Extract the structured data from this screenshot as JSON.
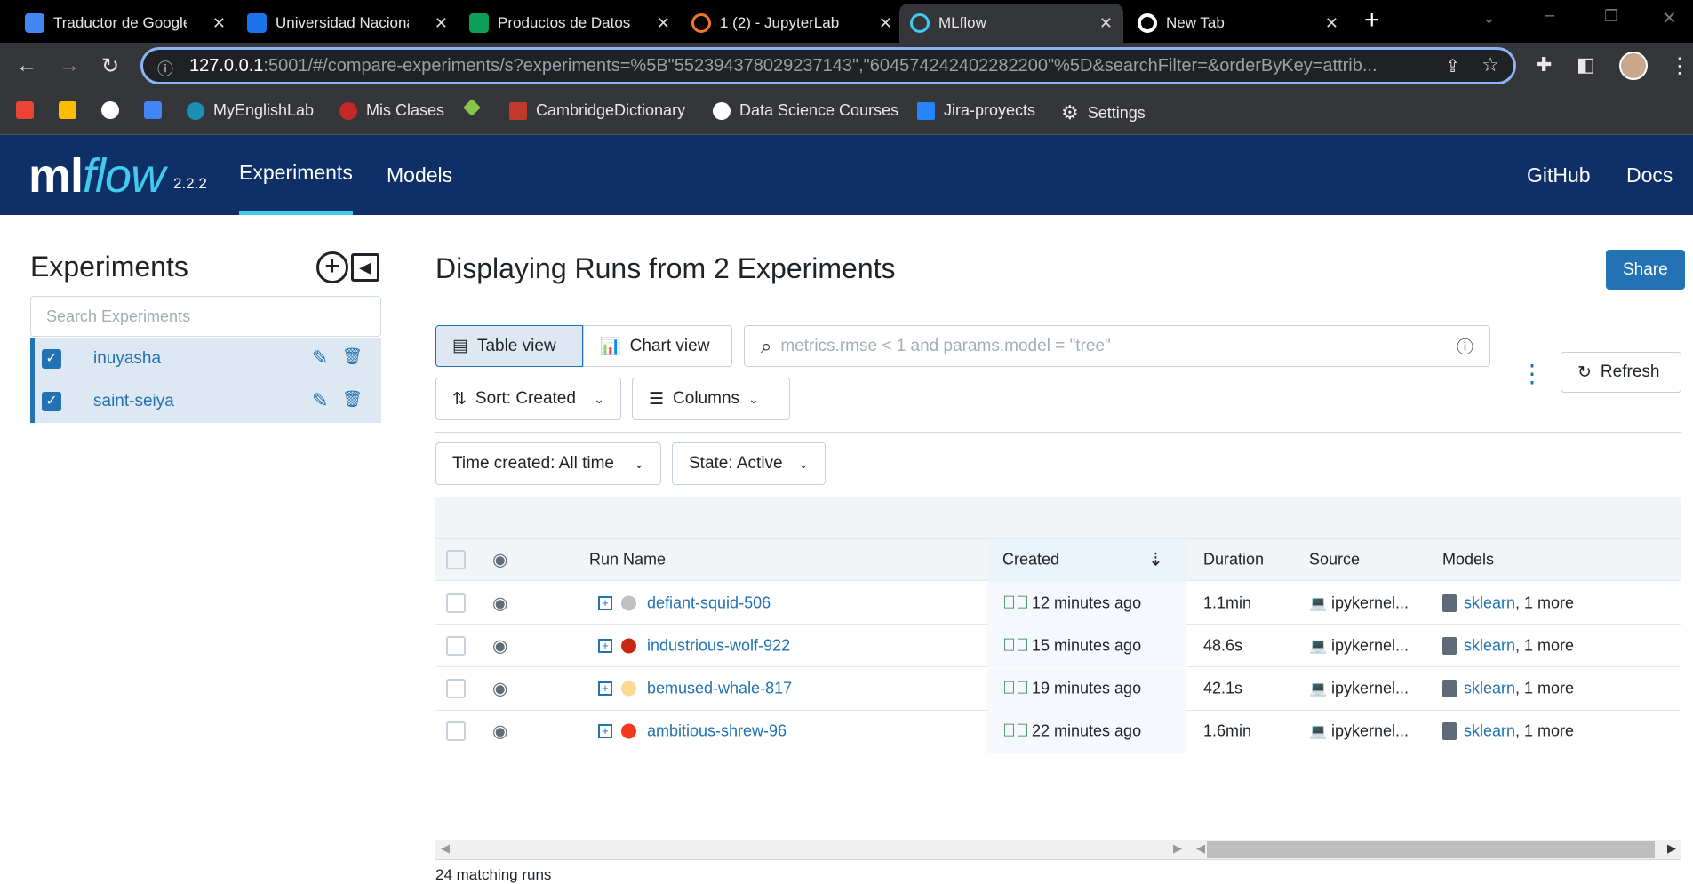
{
  "browser": {
    "tabs": [
      {
        "label": "Traductor de Google",
        "color": "#4285f4"
      },
      {
        "label": "Universidad Nacional",
        "color": "#1a73e8"
      },
      {
        "label": "Productos de Datos",
        "color": "#0f9d58"
      },
      {
        "label": "1 (2) - JupyterLab",
        "color": "#f37726"
      },
      {
        "label": "MLflow",
        "color": "#43c9ed"
      },
      {
        "label": "New Tab",
        "color": "#ffffff"
      }
    ],
    "url_host": "127.0.0.1",
    "url_rest": ":5001/#/compare-experiments/s?experiments=%5B\"552394378029237143\",\"604574242402282200\"%5D&searchFilter=&orderByKey=attrib...",
    "bookmarks": [
      "MyEnglishLab",
      "Mis Clases",
      "CambridgeDictionary",
      "Data Science Courses",
      "Jira-proyects",
      "Settings"
    ]
  },
  "header": {
    "logo_ml": "ml",
    "logo_flow": "flow",
    "version": "2.2.2",
    "nav": [
      "Experiments",
      "Models"
    ],
    "right": [
      "GitHub",
      "Docs"
    ]
  },
  "sidebar": {
    "title": "Experiments",
    "search_placeholder": "Search Experiments",
    "experiments": [
      {
        "name": "inuyasha",
        "checked": true
      },
      {
        "name": "saint-seiya",
        "checked": true
      }
    ]
  },
  "main": {
    "title": "Displaying Runs from 2 Experiments",
    "share": "Share",
    "table_view": "Table view",
    "chart_view": "Chart view",
    "search_placeholder": "metrics.rmse < 1 and params.model = \"tree\"",
    "refresh": "Refresh",
    "sort": "Sort: Created",
    "columns": "Columns",
    "time_filter": "Time created: All time",
    "state_filter": "State: Active",
    "table": {
      "headers": {
        "run_name": "Run Name",
        "created": "Created",
        "duration": "Duration",
        "source": "Source",
        "models": "Models"
      },
      "rows": [
        {
          "name": "defiant-squid-506",
          "color": "#c0c0c0",
          "created": "12 minutes ago",
          "duration": "1.1min",
          "source": "ipykernel...",
          "model": "sklearn",
          "more": ", 1 more"
        },
        {
          "name": "industrious-wolf-922",
          "color": "#c9270f",
          "created": "15 minutes ago",
          "duration": "48.6s",
          "source": "ipykernel...",
          "model": "sklearn",
          "more": ", 1 more"
        },
        {
          "name": "bemused-whale-817",
          "color": "#fcd992",
          "created": "19 minutes ago",
          "duration": "42.1s",
          "source": "ipykernel...",
          "model": "sklearn",
          "more": ", 1 more"
        },
        {
          "name": "ambitious-shrew-96",
          "color": "#f2391c",
          "created": "22 minutes ago",
          "duration": "1.6min",
          "source": "ipykernel...",
          "model": "sklearn",
          "more": ", 1 more"
        }
      ]
    },
    "footer": "24 matching runs"
  }
}
